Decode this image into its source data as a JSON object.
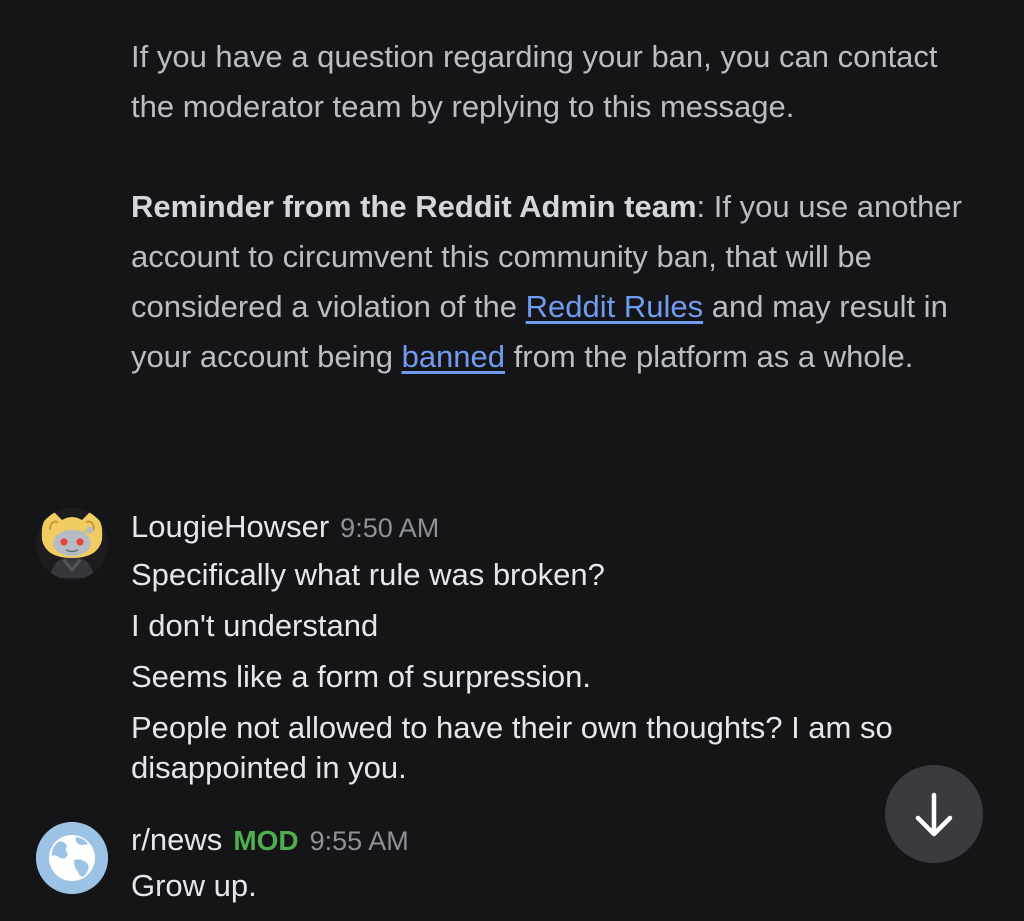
{
  "system_message": {
    "paragraph1": "If you have a question regarding your ban, you can contact the moderator team by replying to this message.",
    "reminder_bold": "Reminder from the Reddit Admin team",
    "reminder_colon": ": ",
    "reminder_text1": "If you use another account to circumvent this community ban, that will be considered a violation of the ",
    "rules_link": "Reddit Rules",
    "reminder_text2": " and may result in your account being ",
    "banned_link": "banned",
    "reminder_text3": " from the platform as a whole."
  },
  "messages": [
    {
      "username": "LougieHowser",
      "time": "9:50 AM",
      "lines": [
        "Specifically what rule was broken?",
        "I don't understand",
        "Seems like a form of surpression.",
        "People not allowed to have their own thoughts? I am so disappointed in you."
      ]
    },
    {
      "username": "r/news",
      "badge": "MOD",
      "time": "9:55 AM",
      "lines": [
        "Grow up."
      ]
    }
  ],
  "colors": {
    "background": "#151517",
    "link": "#6f9cf0",
    "mod_badge": "#4fae4f"
  },
  "icons": {
    "scroll_button": "arrow-down-icon",
    "avatar_1": "snoo-doge-avatar",
    "avatar_2": "globe-icon"
  }
}
